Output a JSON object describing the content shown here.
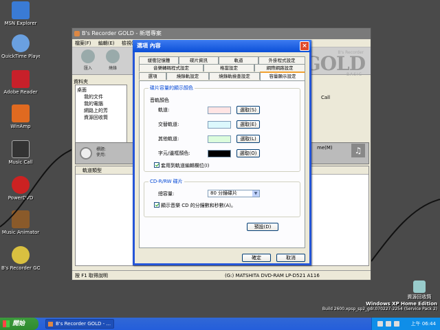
{
  "desktop": {
    "icons": [
      {
        "label": "MSN Explorer"
      },
      {
        "label": "QuickTime Player"
      },
      {
        "label": "Adobe Reader"
      },
      {
        "label": "WinAmp"
      },
      {
        "label": "Music Call"
      },
      {
        "label": "PowerDVD"
      },
      {
        "label": "Music Animator"
      },
      {
        "label": "B's Recorder GOLD BASIC"
      },
      {
        "label": "資源回收筒"
      }
    ],
    "watermark_line1": "Windows XP Home Edition",
    "watermark_line2": "Build 2600.xpsp_sp2_gdr.070227-2254 (Service Pack 2)"
  },
  "app": {
    "title": "B's Recorder GOLD - 新增專案",
    "menu": [
      "檔案(F)",
      "編輯(E)",
      "檢視(V)"
    ],
    "toolbar": [
      "匯入",
      "燒錄"
    ],
    "brand_sub": "B's Recorder",
    "brand": "GOLD",
    "brand_edition": "BASIC",
    "pane_label": "資料夾",
    "tree": [
      "桌面",
      "我的文件",
      "我的電腦",
      "網路上的芳",
      "資源回收筒"
    ],
    "right_label": "Call",
    "disc_info": [
      "標題:",
      "使用:"
    ],
    "me_label": "me(M)",
    "list_header": "軌道類型",
    "status_left": "按 F1 取得說明",
    "status_right": "(G:) MATSHITA DVD-RAM LP-D521  A116"
  },
  "dialog": {
    "title": "選項 內容",
    "tabs_row1": [
      "緩衝記憶體",
      "碟片資訊",
      "軌道",
      "外掛程式設定"
    ],
    "tabs_row2": [
      "音樂轉碼程式設定",
      "格當設定",
      "網際網路設定"
    ],
    "tabs_row3": [
      "選項",
      "燒錄軌設定",
      "燒錄軌檢查設定",
      "容量顯示設定"
    ],
    "group1": {
      "title": "碟片容量的顯示顏色",
      "subtitle": "音軌顏色",
      "rows": [
        {
          "label": "軌道:",
          "color": "#ffe4e4",
          "button": "選取(S)"
        },
        {
          "label": "交替軌道:",
          "color": "#dcf8fc",
          "button": "選取(E)"
        },
        {
          "label": "其他軌道:",
          "color": "#dcfcdc",
          "button": "選取(L)"
        },
        {
          "label": "字元/邊框顏色:",
          "color": "#000000",
          "button": "選取(O)"
        }
      ],
      "checkbox": "套用到軌道編輯欄位(I)"
    },
    "group2": {
      "title": "CD-R/RW 碟片",
      "capacity_label": "總容量:",
      "capacity_value": "80 分鐘碟片",
      "checkbox": "顯示音樂 CD 的分鐘數和秒數(A)。"
    },
    "default_button": "預設(D)",
    "ok_button": "確定",
    "cancel_button": "取消"
  },
  "taskbar": {
    "start": "開始",
    "task": "B's Recorder GOLD - ...",
    "clock": "上午 06:44"
  }
}
